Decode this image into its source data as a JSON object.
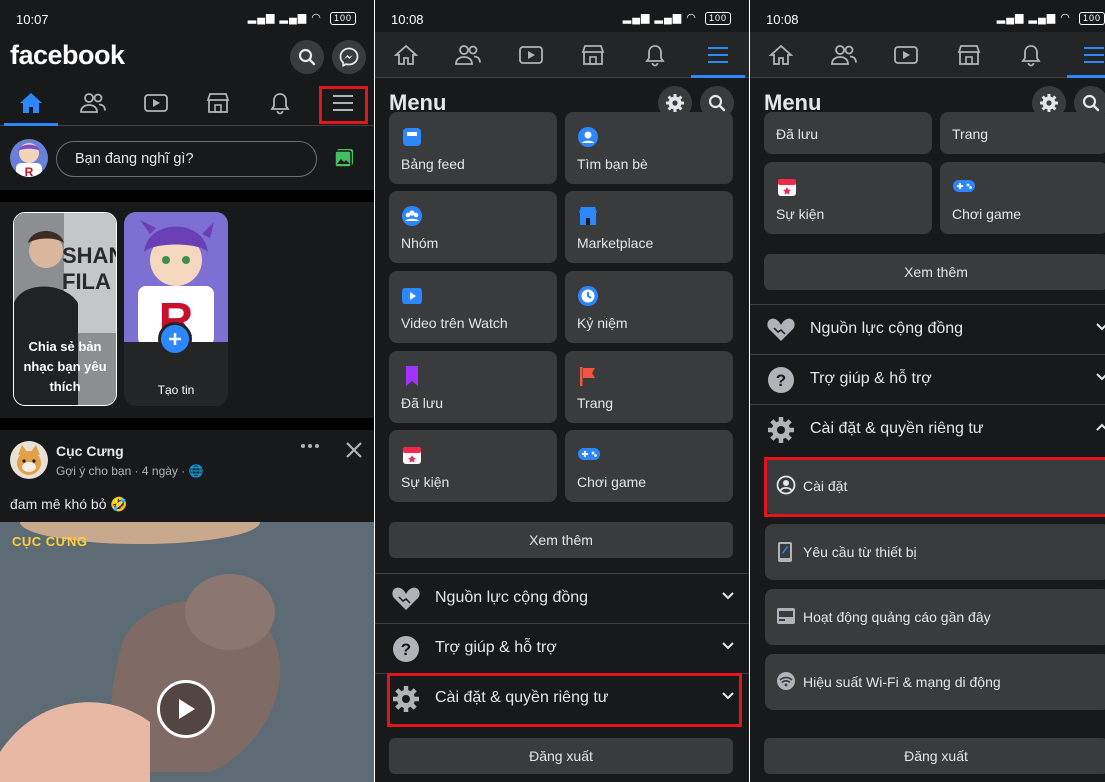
{
  "panel1": {
    "status_time": "10:07",
    "battery": "100",
    "logo": "facebook",
    "search_icon": "search-icon",
    "messenger_icon": "messenger-icon",
    "nav_icons": [
      "home-icon",
      "friends-icon",
      "watch-icon",
      "marketplace-icon",
      "bell-icon",
      "hamburger-menu-icon"
    ],
    "status_placeholder": "Bạn đang nghĩ gì?",
    "stories": [
      {
        "label": "Chia sẻ bản nhạc bạn yêu thích",
        "cover_text": "SHAN FILA"
      },
      {
        "label": "Tạo tin"
      }
    ],
    "post": {
      "author": "Cục Cưng",
      "meta": "Gợi ý cho bạn · 4 ngày · 🌐",
      "text": "đam mê khó bỏ 🤣",
      "video_caption": "CỤC CƯNG"
    }
  },
  "panel2": {
    "status_time": "10:08",
    "battery": "100",
    "title": "Menu",
    "tiles": [
      {
        "label": "Bảng feed",
        "icon": "feed-icon",
        "color": "#2d88ff"
      },
      {
        "label": "Tìm bạn bè",
        "icon": "find-friends-icon",
        "color": "#2d88ff"
      },
      {
        "label": "Nhóm",
        "icon": "groups-icon",
        "color": "#2d88ff"
      },
      {
        "label": "Marketplace",
        "icon": "marketplace-icon",
        "color": "#2d88ff"
      },
      {
        "label": "Video trên Watch",
        "icon": "watch-icon",
        "color": "#2d88ff"
      },
      {
        "label": "Kỷ niệm",
        "icon": "memories-icon",
        "color": "#2d88ff"
      },
      {
        "label": "Đã lưu",
        "icon": "saved-icon",
        "color": "#a033ff"
      },
      {
        "label": "Trang",
        "icon": "pages-flag-icon",
        "color": "#f5533d"
      },
      {
        "label": "Sự kiện",
        "icon": "events-calendar-icon",
        "color": "#f02849"
      },
      {
        "label": "Chơi game",
        "icon": "gaming-icon",
        "color": "#2d88ff"
      }
    ],
    "see_more": "Xem thêm",
    "sections": [
      {
        "label": "Nguồn lực cộng đồng",
        "icon": "heart-hands-icon"
      },
      {
        "label": "Trợ giúp & hỗ trợ",
        "icon": "help-icon"
      },
      {
        "label": "Cài đặt & quyền riêng tư",
        "icon": "gear-icon"
      }
    ],
    "logout": "Đăng xuất"
  },
  "panel3": {
    "status_time": "10:08",
    "battery": "100",
    "title": "Menu",
    "top_tiles": [
      "Đã lưu",
      "Trang"
    ],
    "tiles": [
      {
        "label": "Sự kiện",
        "icon": "events-calendar-icon",
        "color": "#f02849"
      },
      {
        "label": "Chơi game",
        "icon": "gaming-icon",
        "color": "#2d88ff"
      }
    ],
    "see_more": "Xem thêm",
    "sections": [
      {
        "label": "Nguồn lực cộng đồng",
        "icon": "heart-hands-icon"
      },
      {
        "label": "Trợ giúp & hỗ trợ",
        "icon": "help-icon"
      },
      {
        "label": "Cài đặt & quyền riêng tư",
        "icon": "gear-icon"
      }
    ],
    "subitems": [
      {
        "label": "Cài đặt",
        "icon": "profile-settings-icon"
      },
      {
        "label": "Yêu cầu từ thiết bị",
        "icon": "device-request-icon"
      },
      {
        "label": "Hoạt động quảng cáo gần đây",
        "icon": "ads-activity-icon"
      },
      {
        "label": "Hiệu suất Wi-Fi & mạng di động",
        "icon": "wifi-icon"
      }
    ],
    "logout": "Đăng xuất"
  }
}
